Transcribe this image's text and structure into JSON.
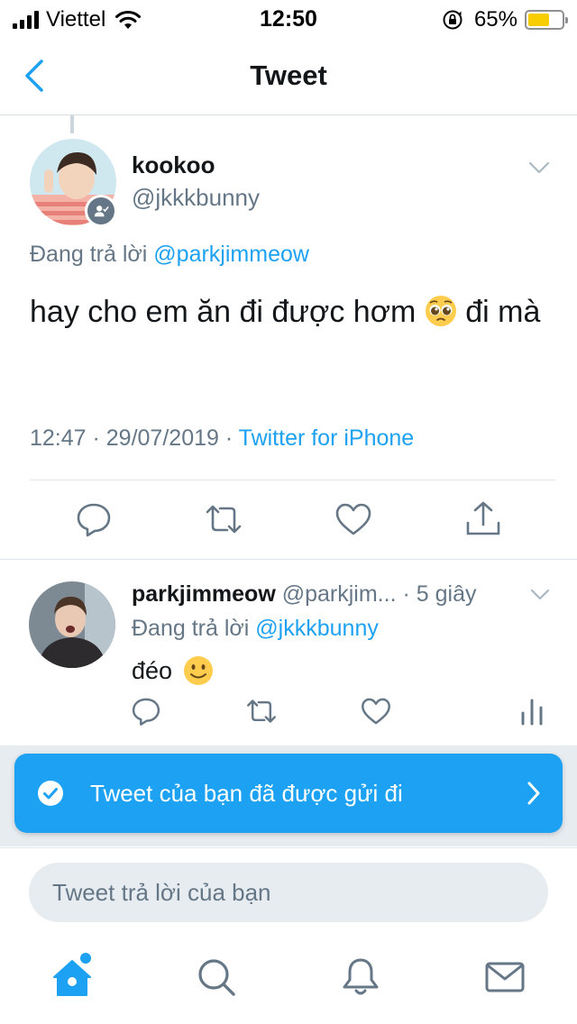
{
  "status_bar": {
    "carrier": "Viettel",
    "time": "12:50",
    "battery_percent": "65%",
    "battery_level": 0.65
  },
  "header": {
    "title": "Tweet"
  },
  "main_tweet": {
    "author_name": "kookoo",
    "author_handle": "@jkkkbunny",
    "replying_label": "Đang trả lời",
    "replying_to": "@parkjimmeow",
    "text": "hay cho em ăn đi được hơm",
    "text_tail": "đi mà",
    "timestamp": "12:47 · 29/07/2019 ·",
    "source": "Twitter for iPhone"
  },
  "reply_tweet": {
    "author_name": "parkjimmeow",
    "author_handle": "@parkjim...",
    "time": "· 5 giây",
    "replying_label": "Đang trả lời",
    "replying_to": "@jkkkbunny",
    "text": "đéo"
  },
  "toast": {
    "message": "Tweet của bạn đã được gửi đi"
  },
  "composer": {
    "placeholder": "Tweet trả lời của bạn"
  },
  "colors": {
    "accent": "#1da1f2",
    "secondary_text": "#657786",
    "battery": "#f7cd00"
  },
  "icons": {
    "main_actions": [
      "reply-icon",
      "retweet-icon",
      "like-icon",
      "share-icon"
    ],
    "reply_actions": [
      "reply-icon",
      "retweet-icon",
      "like-icon",
      "analytics-icon"
    ],
    "tabs": [
      "home-icon",
      "search-icon",
      "notifications-icon",
      "messages-icon"
    ]
  }
}
